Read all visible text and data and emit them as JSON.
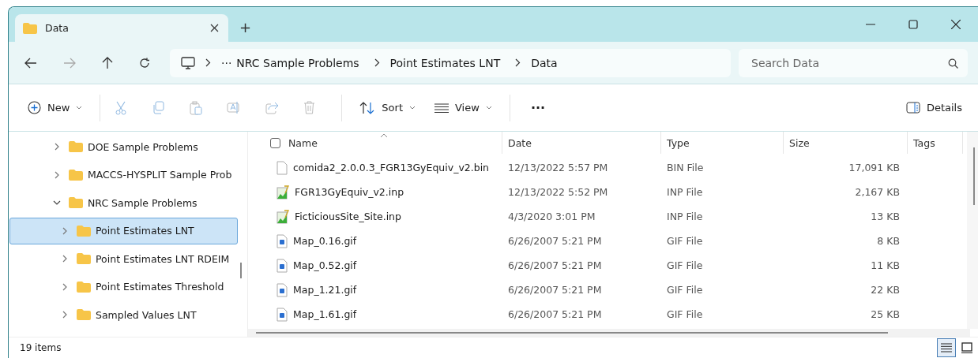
{
  "tab": {
    "title": "Data",
    "new_tab": "+"
  },
  "address": {
    "more": "···",
    "crumbs": [
      "NRC Sample Problems",
      "Point Estimates LNT",
      "Data"
    ]
  },
  "search": {
    "placeholder": "Search Data"
  },
  "toolbar": {
    "new": "New",
    "sort": "Sort",
    "view": "View",
    "more": "···",
    "details": "Details"
  },
  "sidebar": {
    "items": [
      {
        "label": "DOE Sample Problems",
        "expanded": false,
        "selected": false
      },
      {
        "label": "MACCS-HYSPLIT Sample Prob",
        "expanded": false,
        "selected": false
      },
      {
        "label": "NRC Sample Problems",
        "expanded": true,
        "selected": false,
        "children": [
          {
            "label": "Point Estimates LNT",
            "expanded": false,
            "selected": true
          },
          {
            "label": "Point Estimates LNT RDEIM",
            "expanded": false,
            "selected": false
          },
          {
            "label": "Point Estimates Threshold",
            "expanded": false,
            "selected": false
          },
          {
            "label": "Sampled Values LNT",
            "expanded": false,
            "selected": false
          }
        ]
      }
    ]
  },
  "table": {
    "select_all": {
      "checked": false
    },
    "columns": [
      "Name",
      "Date",
      "Type",
      "Size",
      "Tags"
    ],
    "rows": [
      {
        "kind": "blank",
        "name": "comida2_2.0.0.3_FGR13GyEquiv_v2.bin",
        "date": "12/13/2022 5:57 PM",
        "type": "BIN File",
        "size": "17,091 KB"
      },
      {
        "kind": "chart",
        "name": "FGR13GyEquiv_v2.inp",
        "date": "12/13/2022 5:52 PM",
        "type": "INP File",
        "size": "2,167 KB"
      },
      {
        "kind": "chart",
        "name": "FicticiousSite_Site.inp",
        "date": "4/3/2020 3:01 PM",
        "type": "INP File",
        "size": "13 KB"
      },
      {
        "kind": "image",
        "name": "Map_0.16.gif",
        "date": "6/26/2007 5:21 PM",
        "type": "GIF File",
        "size": "8 KB"
      },
      {
        "kind": "image",
        "name": "Map_0.52.gif",
        "date": "6/26/2007 5:21 PM",
        "type": "GIF File",
        "size": "11 KB"
      },
      {
        "kind": "image",
        "name": "Map_1.21.gif",
        "date": "6/26/2007 5:21 PM",
        "type": "GIF File",
        "size": "22 KB"
      },
      {
        "kind": "image",
        "name": "Map_1.61.gif",
        "date": "6/26/2007 5:21 PM",
        "type": "GIF File",
        "size": "25 KB"
      }
    ]
  },
  "status_bar": {
    "count": "19 items",
    "views": [
      {
        "kind": "details",
        "selected": true
      },
      {
        "kind": "tiles",
        "selected": false
      }
    ]
  }
}
